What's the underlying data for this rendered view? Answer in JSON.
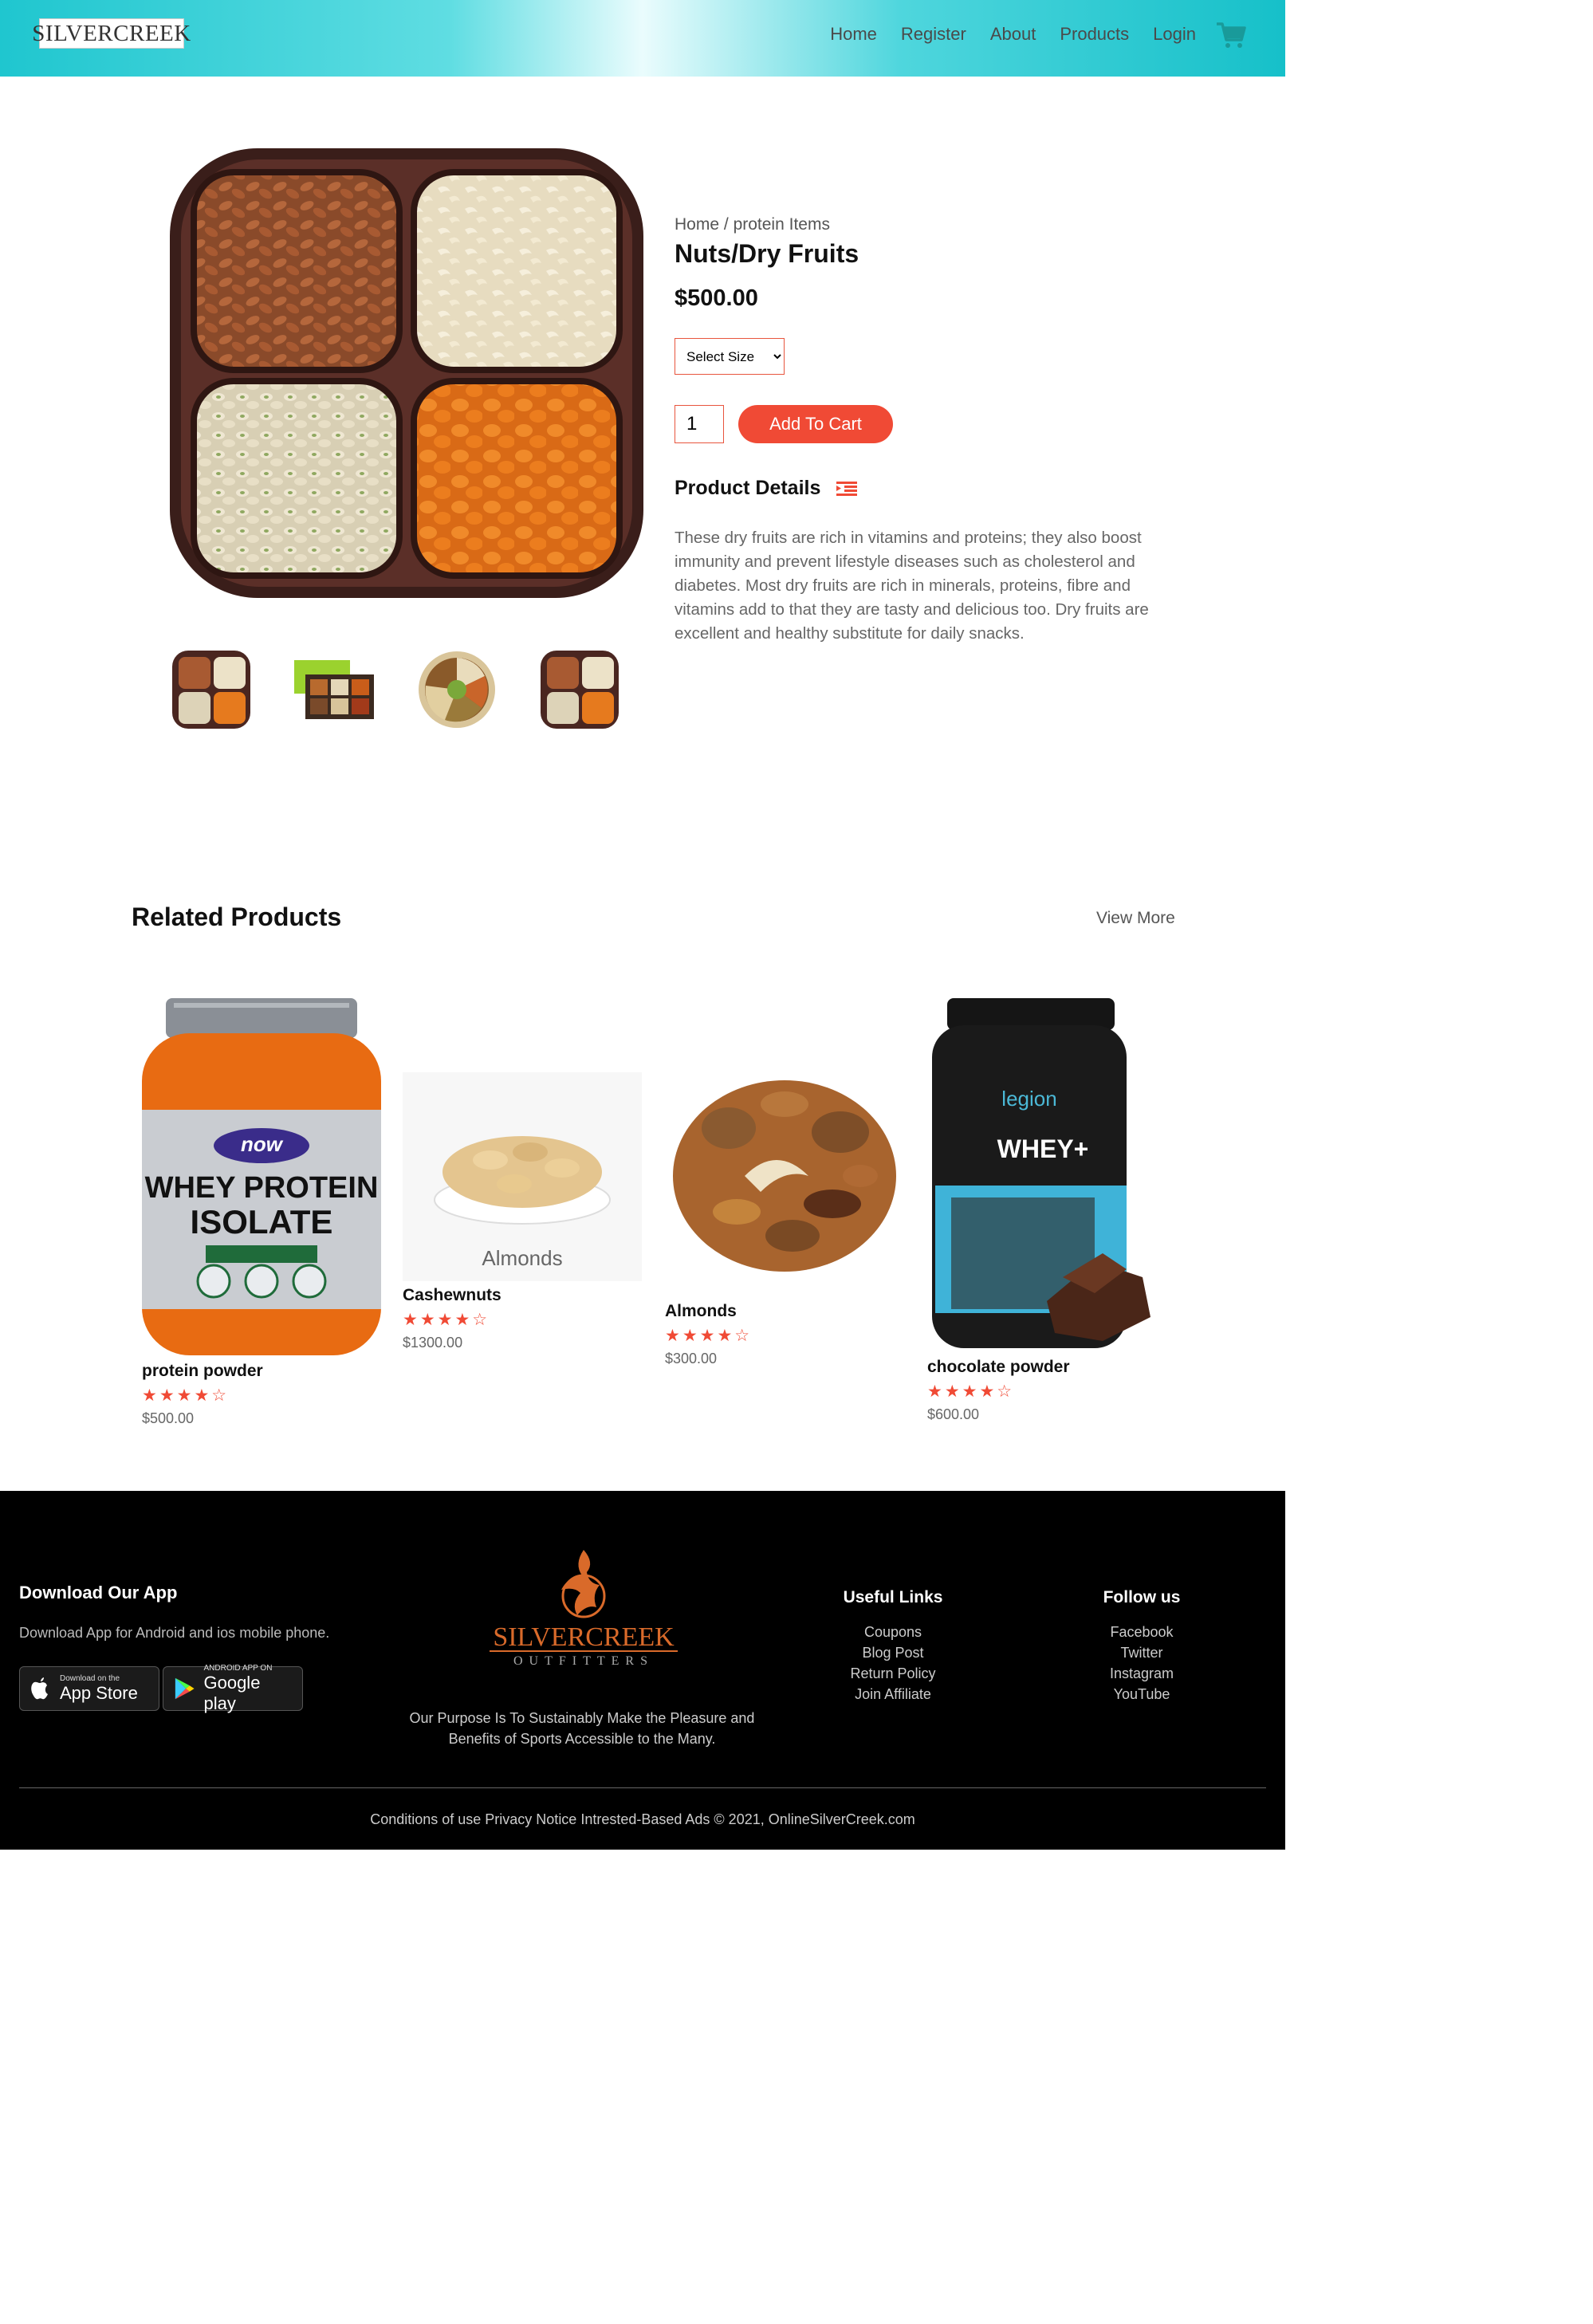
{
  "nav": {
    "logo": "SILVERCREEK",
    "links": [
      "Home",
      "Register",
      "About",
      "Products",
      "Login"
    ],
    "cart_icon": "shopping-cart-icon"
  },
  "product": {
    "breadcrumb_home": "Home",
    "breadcrumb_sep": "/",
    "breadcrumb_category": "protein Items",
    "title": "Nuts/Dry Fruits",
    "price": "$500.00",
    "size_placeholder": "Select Size",
    "quantity": "1",
    "add_to_cart": "Add To Cart",
    "details_heading": "Product Details",
    "description": "These dry fruits are rich in vitamins and proteins; they also boost immunity and prevent lifestyle diseases such as cholesterol and diabetes. Most dry fruits are rich in minerals, proteins, fibre and vitamins add to that they are tasty and delicious too. Dry fruits are excellent and healthy substitute for daily snacks."
  },
  "related": {
    "title": "Related Products",
    "view_more": "View More",
    "items": [
      {
        "name": "protein powder",
        "rating": 4,
        "price": "$500.00",
        "img_text": "WHEY PROTEIN ISOLATE",
        "brand": "now"
      },
      {
        "name": "Cashewnuts",
        "rating": 4,
        "price": "$1300.00",
        "img_text": "Almonds"
      },
      {
        "name": "Almonds",
        "rating": 4,
        "price": "$300.00"
      },
      {
        "name": "chocolate powder",
        "rating": 4,
        "price": "$600.00",
        "img_text": "WHEY+",
        "brand": "legion"
      }
    ]
  },
  "footer": {
    "app_title": "Download Our App",
    "app_text": "Download App for Android and ios mobile phone.",
    "app_store_small": "Download on the",
    "app_store": "App Store",
    "play_small": "ANDROID APP ON",
    "play": "Google play",
    "logo_line1": "SILVERCREEK",
    "logo_line2": "OUTFITTERS",
    "purpose": "Our Purpose Is To Sustainably Make the Pleasure and Benefits of Sports Accessible to the Many.",
    "useful_title": "Useful Links",
    "useful": [
      "Coupons",
      "Blog Post",
      "Return Policy",
      "Join Affiliate"
    ],
    "follow_title": "Follow us",
    "follow": [
      "Facebook",
      "Twitter",
      "Instagram",
      "YouTube"
    ],
    "bottom": "Conditions of use Privacy Notice Intrested-Based Ads © 2021, OnlineSilverCreek.com"
  }
}
